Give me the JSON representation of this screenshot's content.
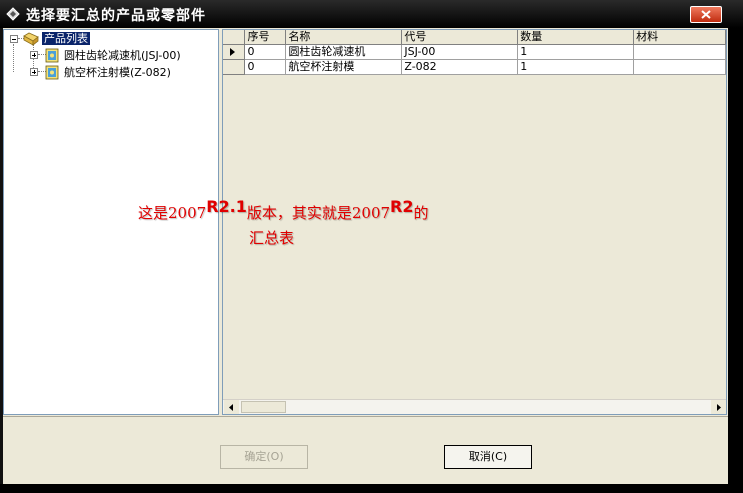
{
  "window": {
    "title": "选择要汇总的产品或零部件"
  },
  "tree": {
    "root": {
      "label": "产品列表",
      "expanded": true,
      "selected": true
    },
    "items": [
      {
        "label": "圆柱齿轮减速机(JSJ-00)",
        "expanded": false
      },
      {
        "label": "航空杯注射模(Z-082)",
        "expanded": false
      }
    ]
  },
  "grid": {
    "columns": [
      "序号",
      "名称",
      "代号",
      "数量",
      "材料"
    ],
    "rows": [
      {
        "current": true,
        "cells": [
          "0",
          "圆柱齿轮减速机",
          "JSJ-00",
          "1",
          ""
        ]
      },
      {
        "current": false,
        "cells": [
          "0",
          "航空杯注射模",
          "Z-082",
          "1",
          ""
        ]
      }
    ]
  },
  "buttons": {
    "ok": {
      "label": "确定(O)",
      "enabled": false
    },
    "cancel": {
      "label": "取消(C)",
      "enabled": true
    }
  },
  "annotation": {
    "line1_a": "这是2007",
    "line1_b": "R2.1",
    "line1_c": "版本，其实就是2007",
    "line1_d": "R2",
    "line1_e": "的",
    "line2": "汇总表"
  },
  "colors": {
    "title_bg": "#000000",
    "dialog_bg": "#ece9d8",
    "close_button": "#d5452a",
    "annotation_text": "#e00000",
    "selection": "#0a246a"
  }
}
